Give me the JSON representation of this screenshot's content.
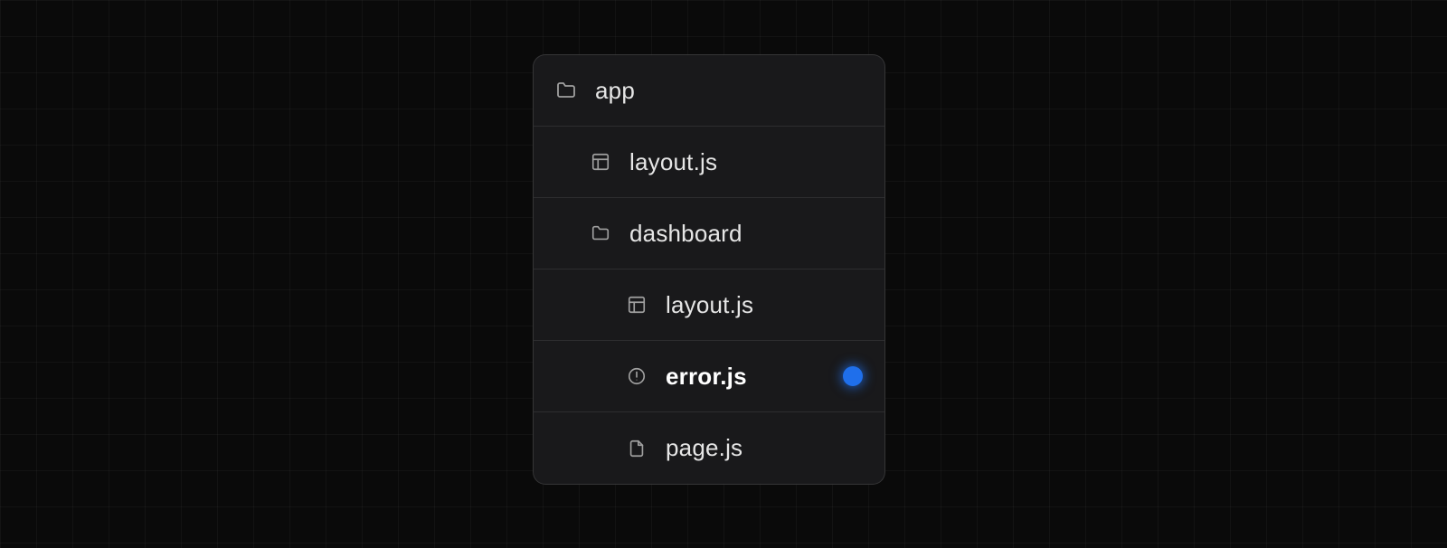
{
  "tree": {
    "root": {
      "icon": "folder",
      "label": "app",
      "depth": 0,
      "highlight": false,
      "dot": false
    },
    "items": [
      {
        "icon": "layout",
        "label": "layout.js",
        "depth": 1,
        "highlight": false,
        "dot": false
      },
      {
        "icon": "folder",
        "label": "dashboard",
        "depth": 1,
        "highlight": false,
        "dot": false
      },
      {
        "icon": "layout",
        "label": "layout.js",
        "depth": 2,
        "highlight": false,
        "dot": false
      },
      {
        "icon": "error",
        "label": "error.js",
        "depth": 2,
        "highlight": true,
        "dot": true
      },
      {
        "icon": "page",
        "label": "page.js",
        "depth": 2,
        "highlight": false,
        "dot": false
      }
    ]
  },
  "colors": {
    "accent": "#1f6feb",
    "panel_bg": "#1c1c1e",
    "text": "#e6e6e6",
    "icon": "#a0a0a0"
  }
}
